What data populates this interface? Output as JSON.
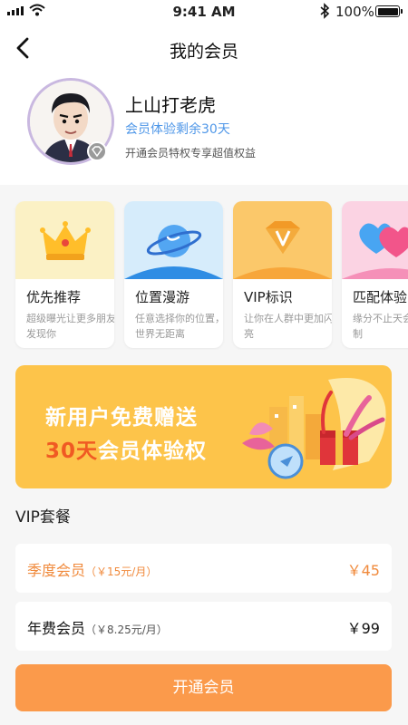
{
  "status_bar": {
    "time": "9:41 AM",
    "battery": "100%"
  },
  "header": {
    "title": "我的会员"
  },
  "profile": {
    "name": "上山打老虎",
    "days_left": "会员体验剩余30天",
    "description": "开通会员特权专享超值权益"
  },
  "privileges": [
    {
      "label": "优先推荐",
      "desc": "超级曝光让更多朋友发现你"
    },
    {
      "label": "位置漫游",
      "desc": "任意选择你的位置，世界无距离"
    },
    {
      "label": "VIP标识",
      "desc": "让你在人群中更加闪亮"
    },
    {
      "label": "匹配体验",
      "desc": "缘分不止天会员无限制"
    }
  ],
  "banner": {
    "line1": "新用户免费赠送",
    "line2_highlight": "30天",
    "line2_rest": "会员体验权"
  },
  "packages": {
    "title": "VIP套餐",
    "items": [
      {
        "name": "季度会员",
        "note": "（￥15元/月）",
        "price": "￥45"
      },
      {
        "name": "年费会员",
        "note": "（￥8.25元/月）",
        "price": "￥99"
      }
    ]
  },
  "cta": {
    "label": "开通会员"
  },
  "colors": {
    "accent_orange": "#fb9a4b",
    "quarterly_text": "#f08a3c",
    "days_blue": "#4f97e8",
    "banner_yellow": "#fdc44a",
    "banner_highlight": "#f05a23"
  }
}
